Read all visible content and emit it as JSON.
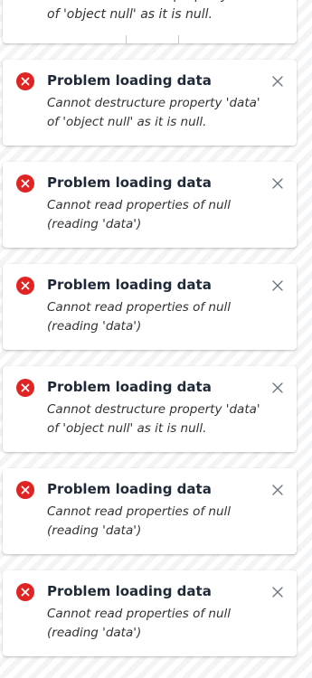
{
  "partial_toast": {
    "message_visible": "Cannot destructure property 'data' of 'object null' as it is null."
  },
  "toasts": [
    {
      "title": "Problem loading data",
      "message": "Cannot destructure property 'data' of 'object null' as it is null.",
      "status_icon": "error-x-circle-icon",
      "close_icon": "close-x-icon"
    },
    {
      "title": "Problem loading data",
      "message": "Cannot read properties of null (reading 'data')",
      "status_icon": "error-x-circle-icon",
      "close_icon": "close-x-icon"
    },
    {
      "title": "Problem loading data",
      "message": "Cannot read properties of null (reading 'data')",
      "status_icon": "error-x-circle-icon",
      "close_icon": "close-x-icon"
    },
    {
      "title": "Problem loading data",
      "message": "Cannot destructure property 'data' of 'object null' as it is null.",
      "status_icon": "error-x-circle-icon",
      "close_icon": "close-x-icon"
    },
    {
      "title": "Problem loading data",
      "message": "Cannot read properties of null (reading 'data')",
      "status_icon": "error-x-circle-icon",
      "close_icon": "close-x-icon"
    },
    {
      "title": "Problem loading data",
      "message": "Cannot read properties of null (reading 'data')",
      "status_icon": "error-x-circle-icon",
      "close_icon": "close-x-icon"
    }
  ],
  "colors": {
    "error": "#e02424",
    "title": "#1f2937",
    "message": "#333333",
    "close": "#6b7280"
  }
}
